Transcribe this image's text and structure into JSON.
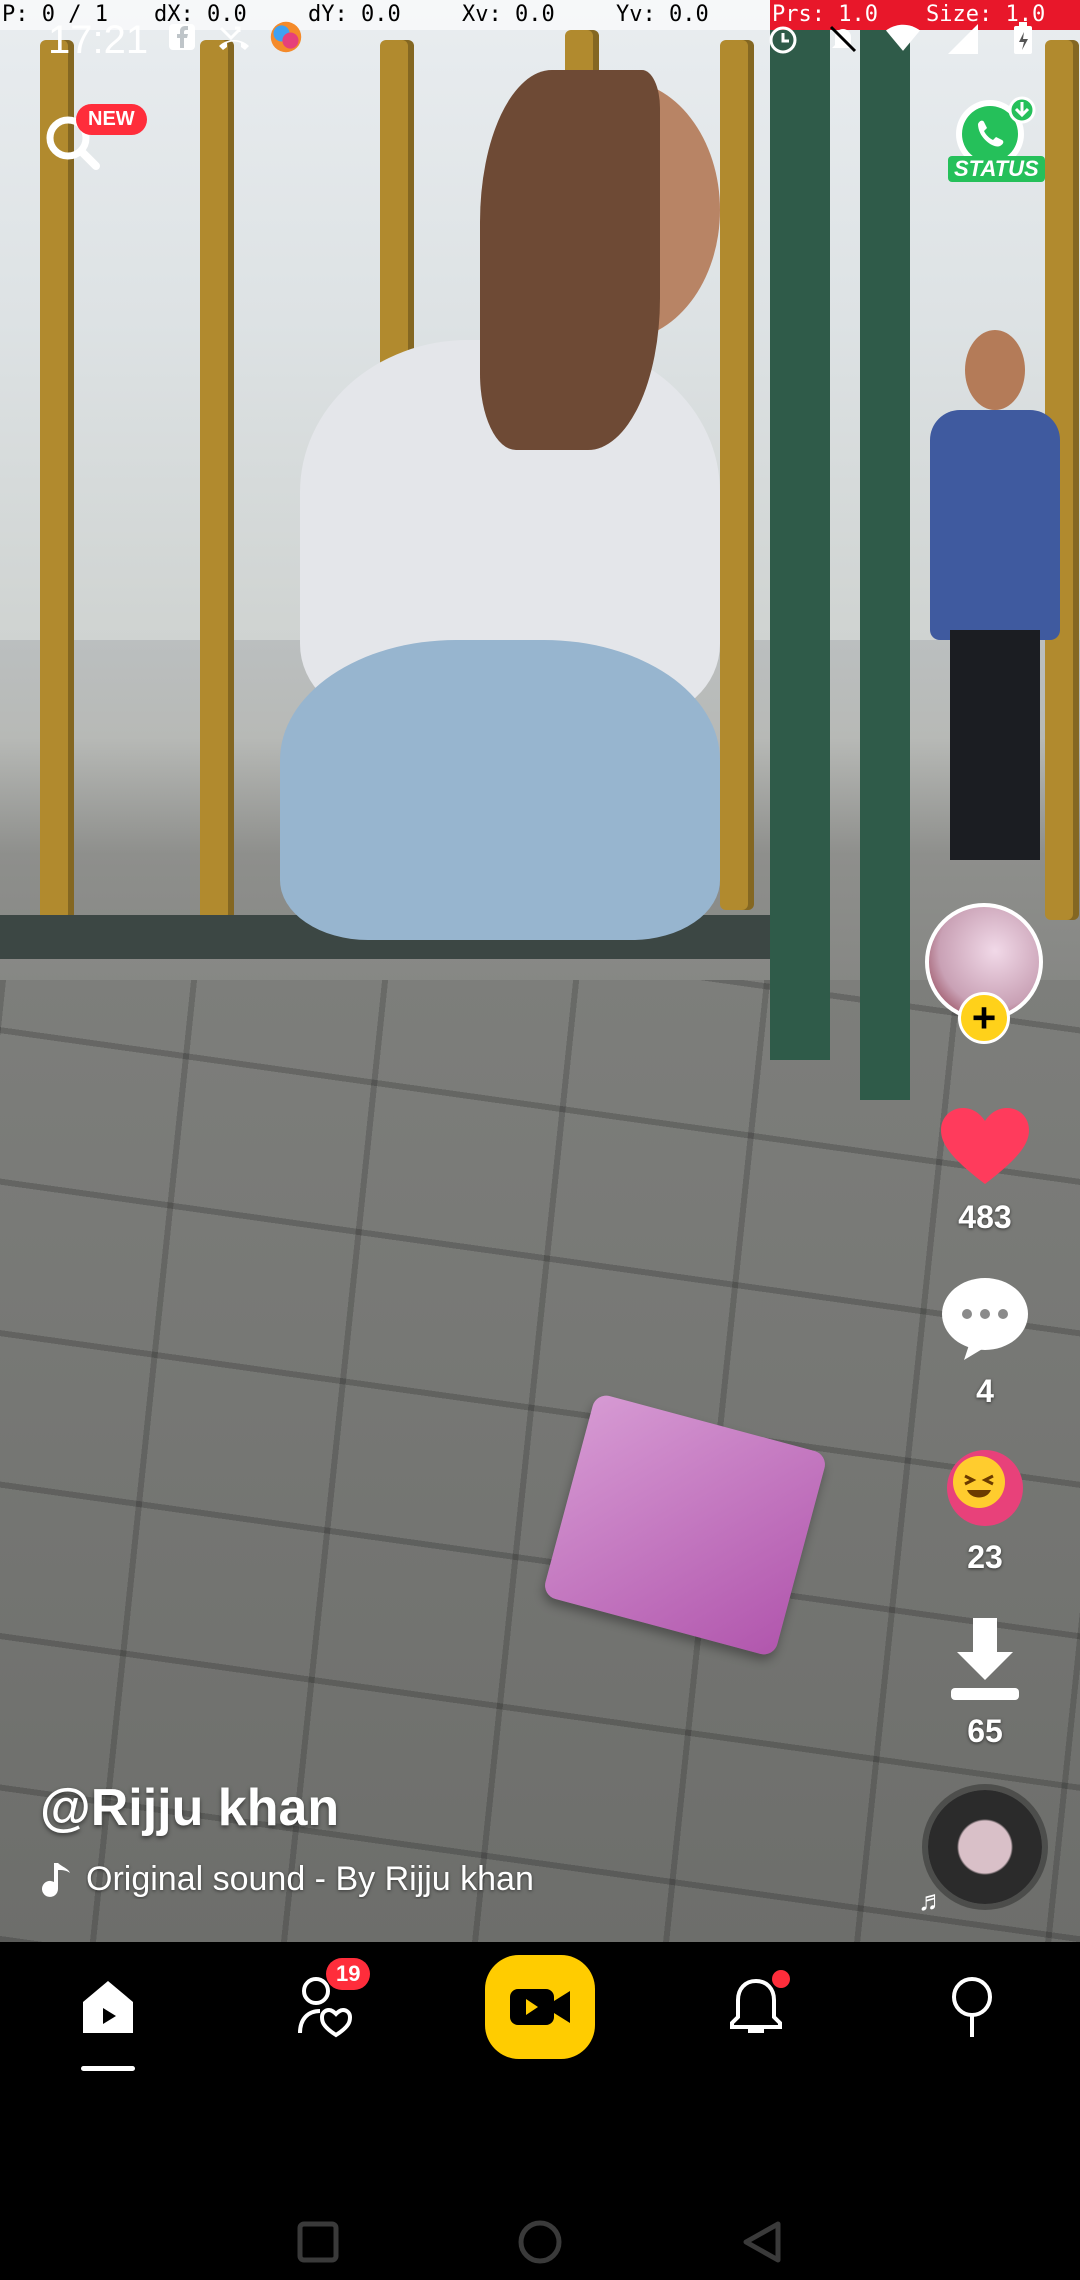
{
  "debug_bar": {
    "pointer": "P: 0 / 1",
    "dx": "dX: 0.0",
    "dy": "dY: 0.0",
    "xv": "Xv: 0.0",
    "yv": "Yv: 0.0",
    "prs": "Prs: 1.0",
    "size": "Size: 1.0"
  },
  "status_bar": {
    "time": "17:21"
  },
  "top": {
    "new_badge": "NEW",
    "whatsapp_status_label": "STATUS"
  },
  "actions": {
    "likes": "483",
    "comments": "4",
    "reactions": "23",
    "downloads": "65"
  },
  "post": {
    "username": "@Rijju khan",
    "sound": "Original sound - By Rijju khan"
  },
  "nav": {
    "following_badge": "19"
  },
  "colors": {
    "accent_yellow": "#ffcc00",
    "badge_red": "#ff2d3b",
    "like_red": "#ff3b5c",
    "whatsapp_green": "#25c05a"
  }
}
